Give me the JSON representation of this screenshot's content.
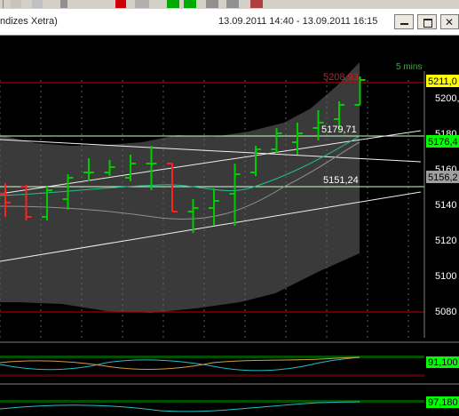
{
  "window": {
    "title": "ndizes Xetra)",
    "range": "13.09.2011 14:40 - 13.09.2011 16:15",
    "interval": "5 mins"
  },
  "price_axis": {
    "ticks": [
      "5200,",
      "5180",
      "5160",
      "5140",
      "5120",
      "5100",
      "5080"
    ],
    "badges": [
      "5211,0",
      "5176,4",
      "5156,2"
    ]
  },
  "annotations": [
    "5208,93",
    "5179,71",
    "5151,24"
  ],
  "indicators": [
    "91,100",
    "97,180"
  ],
  "colors": {
    "up": "#00cc00",
    "down": "#ff2020",
    "level": "#cc0000",
    "band": "#3a3a3a",
    "badge_yellow": "#ffff00",
    "badge_green": "#00ff00"
  },
  "chart_data": {
    "type": "ohlc",
    "ylim": [
      5065,
      5215
    ],
    "bars": [
      {
        "o": 5146,
        "h": 5152,
        "l": 5133,
        "c": 5141
      },
      {
        "o": 5150,
        "h": 5151,
        "l": 5131,
        "c": 5133
      },
      {
        "o": 5133,
        "h": 5150,
        "l": 5131,
        "c": 5148
      },
      {
        "o": 5143,
        "h": 5157,
        "l": 5137,
        "c": 5155
      },
      {
        "o": 5158,
        "h": 5166,
        "l": 5153,
        "c": 5158
      },
      {
        "o": 5158,
        "h": 5165,
        "l": 5156,
        "c": 5161
      },
      {
        "o": 5155,
        "h": 5168,
        "l": 5153,
        "c": 5163
      },
      {
        "o": 5163,
        "h": 5173,
        "l": 5148,
        "c": 5163
      },
      {
        "o": 5163,
        "h": 5163,
        "l": 5136,
        "c": 5136
      },
      {
        "o": 5136,
        "h": 5143,
        "l": 5124,
        "c": 5138
      },
      {
        "o": 5138,
        "h": 5149,
        "l": 5128,
        "c": 5142
      },
      {
        "o": 5146,
        "h": 5163,
        "l": 5128,
        "c": 5157
      },
      {
        "o": 5158,
        "h": 5173,
        "l": 5156,
        "c": 5171
      },
      {
        "o": 5171,
        "h": 5183,
        "l": 5169,
        "c": 5180
      },
      {
        "o": 5175,
        "h": 5186,
        "l": 5168,
        "c": 5180
      },
      {
        "o": 5183,
        "h": 5193,
        "l": 5176,
        "c": 5186
      },
      {
        "o": 5188,
        "h": 5198,
        "l": 5182,
        "c": 5196
      },
      {
        "o": 5196,
        "h": 5212,
        "l": 5196,
        "c": 5210
      }
    ],
    "levels": [
      5208.93,
      5179.71,
      5151.24
    ]
  }
}
